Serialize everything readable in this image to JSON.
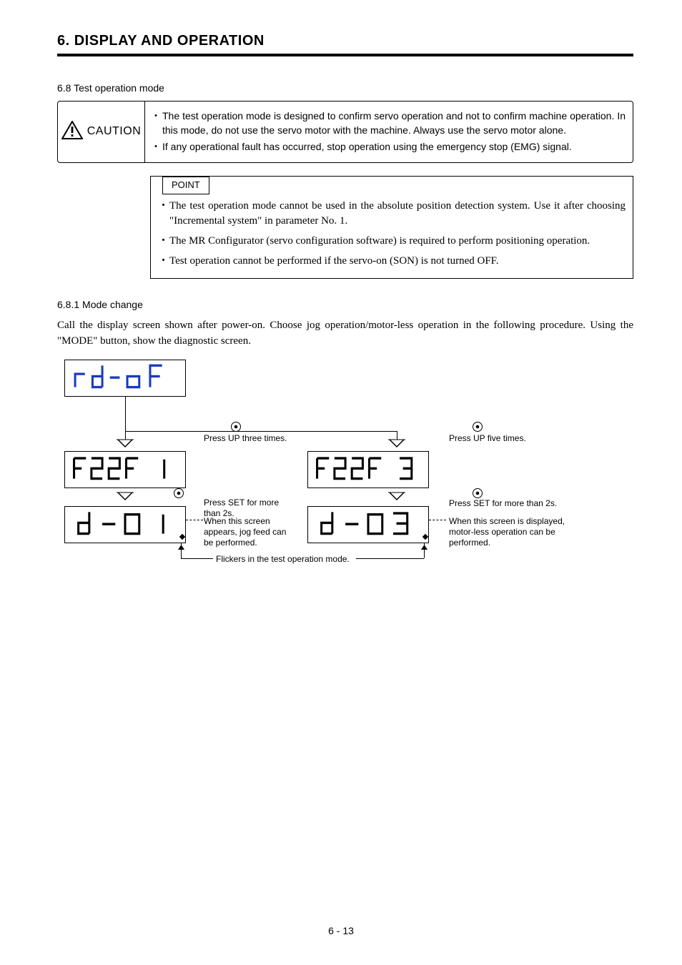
{
  "chapter": {
    "title": "6. DISPLAY AND OPERATION"
  },
  "section": {
    "number": "6.8",
    "title": "6.8 Test operation mode"
  },
  "caution": {
    "label": "CAUTION",
    "items": [
      "The test operation mode is designed to confirm servo operation and not to confirm machine operation. In this mode, do not use the servo motor with the machine. Always use the servo motor alone.",
      "If any operational fault has occurred, stop operation using the emergency stop (EMG) signal."
    ]
  },
  "point": {
    "label": "POINT",
    "items": [
      "The test operation mode cannot be used in the absolute position detection system. Use it after choosing \"Incremental system\" in parameter No. 1.",
      "The MR Configurator (servo configuration software) is required to perform positioning operation.",
      "Test operation cannot be performed if the servo-on (SON) is not turned OFF."
    ]
  },
  "subsection": {
    "title": "6.8.1 Mode change",
    "body": "Call the display screen shown after power-on. Choose jog operation/motor-less operation in the following procedure. Using the \"MODE\" button, show the diagnostic screen.",
    "mode_literal": "\"MODE\""
  },
  "diagram": {
    "top_display": "rd-oF",
    "left_mid_display": "TEST1",
    "right_mid_display": "TEST3",
    "left_bot_display": "d-01",
    "right_bot_display": "d-03",
    "press_up_three": "Press UP three times.",
    "press_up_five": "Press UP five times.",
    "press_set_left_a": "Press SET for more",
    "press_set_left_b": "than 2s.",
    "press_set_right": "Press SET for more than 2s.",
    "jog_text_a": "When this screen",
    "jog_text_b": "appears, jog feed can",
    "jog_text_c": "be performed.",
    "motorless_text_a": "When this screen is displayed,",
    "motorless_text_b": "motor-less operation can be",
    "motorless_text_c": "performed.",
    "flicker": "Flickers in the test operation mode."
  },
  "footer": {
    "page": "6 -  13"
  }
}
